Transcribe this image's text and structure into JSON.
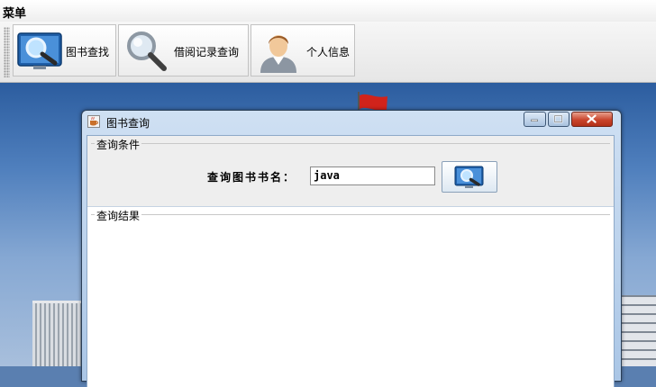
{
  "menubar": {
    "menu_label": "菜单"
  },
  "toolbar": {
    "buttons": [
      {
        "label": "图书查找",
        "icon": "magnifier-screen-icon"
      },
      {
        "label": "借阅记录查询",
        "icon": "magnifier-icon"
      },
      {
        "label": "个人信息",
        "icon": "user-avatar-icon"
      }
    ]
  },
  "frame": {
    "title": "图书查询",
    "condition_panel": {
      "title": "查询条件",
      "book_name_label": "查询图书书名：",
      "book_name_value": "java",
      "search_button_icon": "magnifier-screen-icon"
    },
    "result_panel": {
      "title": "查询结果"
    }
  },
  "colors": {
    "accent": "#2c5d9f",
    "close_button": "#c9452c",
    "frame_border": "#2a3e56"
  }
}
